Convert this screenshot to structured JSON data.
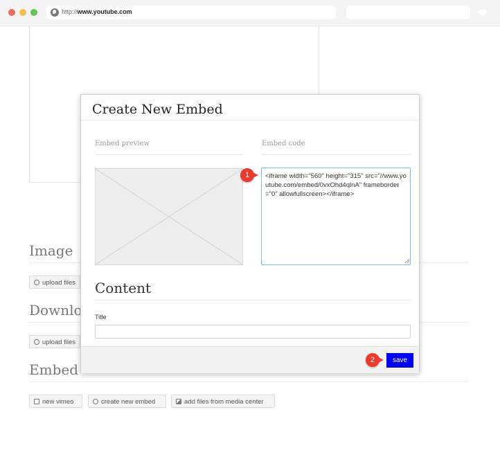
{
  "browser": {
    "url_protocol": "http://",
    "url_host": "www.youtube.com",
    "icons": [
      "globe-icon",
      "heart-icon"
    ],
    "traffic_light_colors": [
      "#ee6a5e",
      "#f5be4f",
      "#62c554"
    ]
  },
  "background": {
    "sections": [
      {
        "title": "Image",
        "buttons": [
          {
            "label": "upload files",
            "icon": "upload-icon"
          }
        ]
      },
      {
        "title": "Downloa",
        "buttons": [
          {
            "label": "upload files",
            "icon": "upload-icon"
          }
        ]
      },
      {
        "title": "Embed",
        "buttons": [
          {
            "label": "new vimeo",
            "icon": "film-icon"
          },
          {
            "label": "create new embed",
            "icon": "plus-circle-icon"
          },
          {
            "label": "add files from media center",
            "icon": "image-icon"
          }
        ]
      }
    ]
  },
  "modal": {
    "title": "Create New Embed",
    "preview_label": "Embed preview",
    "code_label": "Embed code",
    "embed_code": "<iframe width=\"560\" height=\"315\" src=\"//www.youtube.com/embed/0vxOhd4qlnA\" frameborder=\"0\" allowfullscreen></iframe>",
    "content_heading": "Content",
    "title_field_label": "Title",
    "title_field_value": "",
    "save_label": "save"
  },
  "callouts": [
    "1",
    "2"
  ],
  "colors": {
    "save_button": "#0000ee",
    "callout": "#e83b2e",
    "focus_border": "#7ab7e6"
  }
}
